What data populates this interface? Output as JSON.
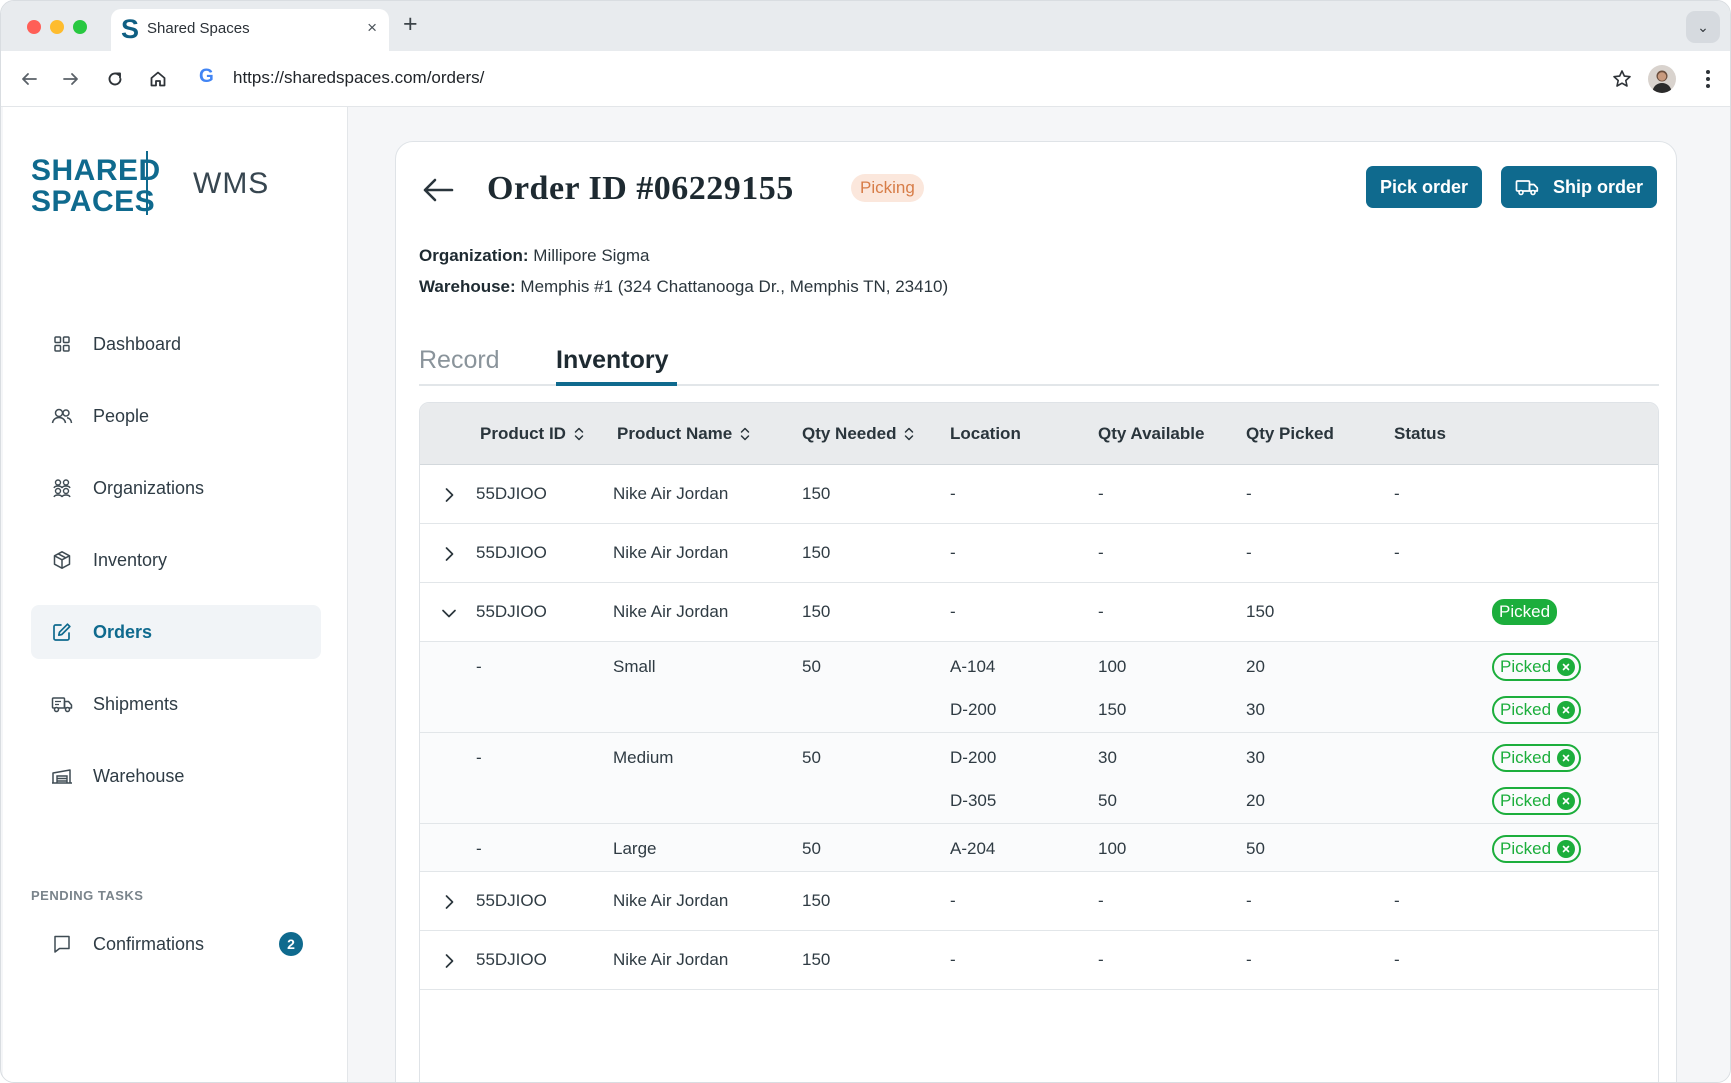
{
  "browser": {
    "tab_title": "Shared Spaces",
    "tab_favicon": "S",
    "tab_close": "×",
    "new_tab": "+",
    "tab_menu": "⌄",
    "url": "https://sharedspaces.com/orders/",
    "search_engine_glyph": "G"
  },
  "sidebar": {
    "logo_line1": "SHARED",
    "logo_line2": "SPACES",
    "logo_suffix": "WMS",
    "items": [
      {
        "label": "Dashboard",
        "icon": "grid-icon",
        "active": false
      },
      {
        "label": "People",
        "icon": "people-icon",
        "active": false
      },
      {
        "label": "Organizations",
        "icon": "organizations-icon",
        "active": false
      },
      {
        "label": "Inventory",
        "icon": "box-icon",
        "active": false
      },
      {
        "label": "Orders",
        "icon": "edit-icon",
        "active": true
      },
      {
        "label": "Shipments",
        "icon": "truck-icon",
        "active": false
      },
      {
        "label": "Warehouse",
        "icon": "warehouse-icon",
        "active": false
      }
    ],
    "pending_title": "PENDING TASKS",
    "confirmations": {
      "label": "Confirmations",
      "count": "2"
    }
  },
  "order": {
    "title": "Order ID #06229155",
    "status": "Picking",
    "pick_button": "Pick order",
    "ship_button": "Ship order",
    "organization_label": "Organization:",
    "organization_value": "Millipore Sigma",
    "warehouse_label": "Warehouse:",
    "warehouse_value": "Memphis #1 (324 Chattanooga Dr., Memphis TN, 23410)"
  },
  "tabs": {
    "record": "Record",
    "inventory": "Inventory"
  },
  "table": {
    "columns": [
      "Product ID",
      "Product Name",
      "Qty Needed",
      "Location",
      "Qty Available",
      "Qty Picked",
      "Status"
    ],
    "rows": [
      {
        "id": "55DJIOO",
        "name": "Nike Air Jordan",
        "qty_needed": "150",
        "location": "-",
        "qty_available": "-",
        "qty_picked": "-",
        "status": "-"
      },
      {
        "id": "55DJIOO",
        "name": "Nike Air Jordan",
        "qty_needed": "150",
        "location": "-",
        "qty_available": "-",
        "qty_picked": "-",
        "status": "-"
      },
      {
        "id": "55DJIOO",
        "name": "Nike Air Jordan",
        "qty_needed": "150",
        "location": "-",
        "qty_available": "-",
        "qty_picked": "150",
        "status": "Picked"
      },
      {
        "id": "55DJIOO",
        "name": "Nike Air Jordan",
        "qty_needed": "150",
        "location": "-",
        "qty_available": "-",
        "qty_picked": "-",
        "status": "-"
      },
      {
        "id": "55DJIOO",
        "name": "Nike Air Jordan",
        "qty_needed": "150",
        "location": "-",
        "qty_available": "-",
        "qty_picked": "-",
        "status": "-"
      }
    ],
    "sub_rows": [
      {
        "id": "-",
        "name": "Small",
        "qty_needed": "50",
        "locations": [
          {
            "location": "A-104",
            "qty_available": "100",
            "qty_picked": "20",
            "status": "Picked"
          },
          {
            "location": "D-200",
            "qty_available": "150",
            "qty_picked": "30",
            "status": "Picked"
          }
        ]
      },
      {
        "id": "-",
        "name": "Medium",
        "qty_needed": "50",
        "locations": [
          {
            "location": "D-200",
            "qty_available": "30",
            "qty_picked": "30",
            "status": "Picked"
          },
          {
            "location": "D-305",
            "qty_available": "50",
            "qty_picked": "20",
            "status": "Picked"
          }
        ]
      },
      {
        "id": "-",
        "name": "Large",
        "qty_needed": "50",
        "locations": [
          {
            "location": "A-204",
            "qty_available": "100",
            "qty_picked": "50",
            "status": "Picked"
          }
        ]
      }
    ]
  },
  "colors": {
    "brand": "#0f6a8e",
    "picked_green": "#1cae3c",
    "picking_pill_bg": "#fbe7dc",
    "picking_pill_text": "#d77d48"
  }
}
